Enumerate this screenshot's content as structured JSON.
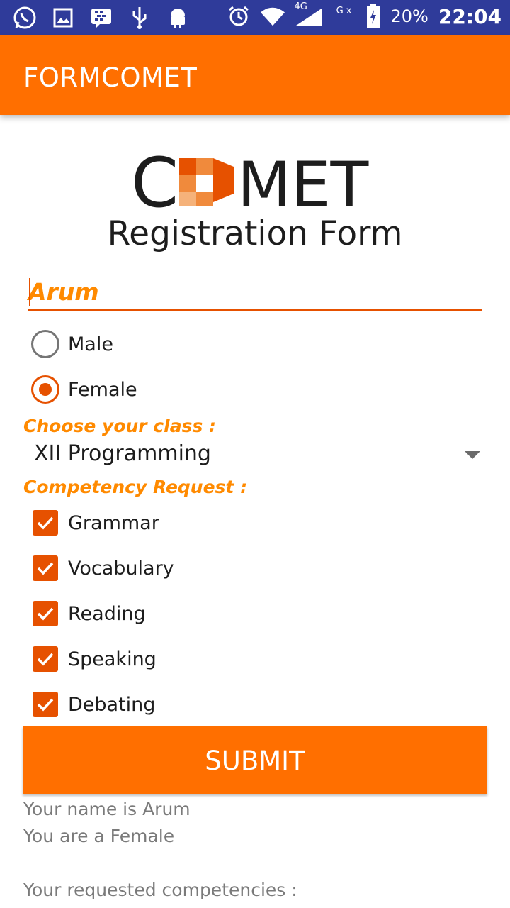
{
  "status_bar": {
    "left_icons": [
      "whatsapp-icon",
      "image-icon",
      "bbm-icon",
      "usb-icon",
      "android-icon"
    ],
    "right_icons": [
      "alarm-icon",
      "wifi-icon",
      "signal-4g-icon",
      "signal-g-icon",
      "battery-charging-icon"
    ],
    "network_4g": "4G",
    "network_g": "G x",
    "battery": "20%",
    "time": "22:04"
  },
  "app_bar": {
    "title": "FORMCOMET"
  },
  "logo": {
    "text_c": "C",
    "text_rest": "MET",
    "colors": [
      "#e65100",
      "#f08a3c",
      "#f5b27a",
      "#1d1d1d"
    ]
  },
  "heading": "Registration Form",
  "name_field": {
    "value": "Arum"
  },
  "gender": {
    "options": [
      {
        "label": "Male",
        "checked": false
      },
      {
        "label": "Female",
        "checked": true
      }
    ]
  },
  "class_section": {
    "label": "Choose your class :",
    "selected": "XII Programming"
  },
  "competency_section": {
    "label": "Competency Request :",
    "items": [
      {
        "label": "Grammar",
        "checked": true
      },
      {
        "label": "Vocabulary",
        "checked": true
      },
      {
        "label": "Reading",
        "checked": true
      },
      {
        "label": "Speaking",
        "checked": true
      },
      {
        "label": "Debating",
        "checked": true
      }
    ]
  },
  "submit_label": "SUBMIT",
  "result": {
    "name_line": "Your name is Arum",
    "gender_line": "You are a Female",
    "competencies_line": "Your requested competencies :"
  },
  "colors": {
    "primary": "#ff6f00",
    "accent": "#e65100",
    "status_bar": "#2f3b9a",
    "label": "#ff8a00"
  }
}
